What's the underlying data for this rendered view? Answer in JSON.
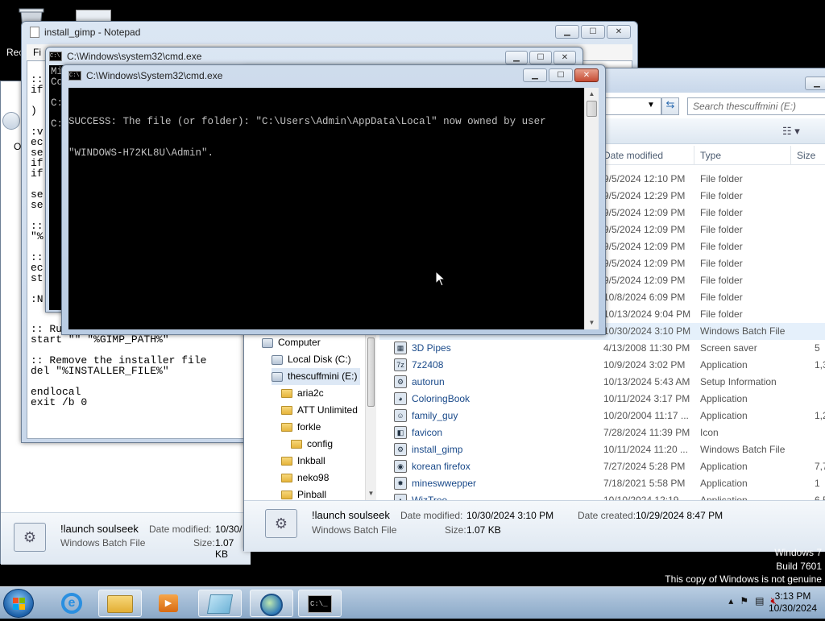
{
  "notepad": {
    "title": "install_gimp - Notepad",
    "menu_first": "Fi",
    "lines": [
      "::",
      "if",
      "",
      ")",
      "",
      ":v",
      "ec",
      "se",
      "if",
      "if",
      "",
      "se",
      "se",
      "",
      "::",
      "\"%",
      "",
      "::",
      "ec",
      "st",
      "",
      ":N"
    ],
    "bottom_lines": [
      ":: Ru",
      "start \"\" \"%GIMP_PATH%\"",
      "",
      ":: Remove the installer file",
      "del \"%INSTALLER_FILE%\"",
      "",
      "endlocal",
      "exit /b 0"
    ]
  },
  "cmd_back": {
    "title": "C:\\Windows\\system32\\cmd.exe",
    "lines": [
      "Mi",
      "Co",
      "",
      "C:",
      "",
      "C:"
    ]
  },
  "cmd_front": {
    "title": "C:\\Windows\\System32\\cmd.exe",
    "output_line1": "SUCCESS: The file (or folder): \"C:\\Users\\Admin\\AppData\\Local\" now owned by user",
    "output_line2": "\"WINDOWS-H72KL8U\\Admin\"."
  },
  "explorer": {
    "search_placeholder": "Search thescuffmini (E:)",
    "columns": {
      "date": "Date modified",
      "type": "Type",
      "size": "Size"
    },
    "folder_rows": [
      {
        "date": "9/5/2024 12:10 PM",
        "type": "File folder"
      },
      {
        "date": "9/5/2024 12:29 PM",
        "type": "File folder"
      },
      {
        "date": "9/5/2024 12:09 PM",
        "type": "File folder"
      },
      {
        "date": "9/5/2024 12:09 PM",
        "type": "File folder"
      },
      {
        "date": "9/5/2024 12:09 PM",
        "type": "File folder"
      },
      {
        "date": "9/5/2024 12:09 PM",
        "type": "File folder"
      },
      {
        "date": "9/5/2024 12:09 PM",
        "type": "File folder"
      },
      {
        "date": "10/8/2024 6:09 PM",
        "type": "File folder"
      },
      {
        "date": "10/13/2024 9:04 PM",
        "type": "File folder"
      },
      {
        "date": "10/30/2024 3:10 PM",
        "type": "Windows Batch File"
      }
    ],
    "file_rows": [
      {
        "name": "3D Pipes",
        "date": "4/13/2008 11:30 PM",
        "type": "Screen saver",
        "size": "5",
        "icon": "screensaver-icon"
      },
      {
        "name": "7z2408",
        "date": "10/9/2024 3:02 PM",
        "type": "Application",
        "size": "1,3",
        "icon": "7zip-icon"
      },
      {
        "name": "autorun",
        "date": "10/13/2024 5:43 AM",
        "type": "Setup Information",
        "size": "",
        "icon": "setup-info-icon"
      },
      {
        "name": "ColoringBook",
        "date": "10/11/2024 3:17 PM",
        "type": "Application",
        "size": "",
        "icon": "palette-icon"
      },
      {
        "name": "family_guy",
        "date": "10/20/2004 11:17 ...",
        "type": "Application",
        "size": "1,2",
        "icon": "app-icon"
      },
      {
        "name": "favicon",
        "date": "7/28/2024 11:39 PM",
        "type": "Icon",
        "size": "",
        "icon": "favicon-icon"
      },
      {
        "name": "install_gimp",
        "date": "10/11/2024 11:20 ...",
        "type": "Windows Batch File",
        "size": "",
        "icon": "batch-file-icon"
      },
      {
        "name": "korean firefox",
        "date": "7/27/2024 5:28 PM",
        "type": "Application",
        "size": "7,7",
        "icon": "firefox-icon"
      },
      {
        "name": "mineswwepper",
        "date": "7/18/2021 5:58 PM",
        "type": "Application",
        "size": "1",
        "icon": "minesweeper-icon"
      },
      {
        "name": "WizTree",
        "date": "10/10/2024 12:19 ...",
        "type": "Application",
        "size": "6,5",
        "icon": "wiztree-icon"
      }
    ],
    "tree": [
      {
        "label": "Computer",
        "indent": 0,
        "icon": "computer-icon"
      },
      {
        "label": "Local Disk (C:)",
        "indent": 1,
        "icon": "drive-icon"
      },
      {
        "label": "thescuffmini (E:)",
        "indent": 1,
        "icon": "usb-drive-icon",
        "selected": true
      },
      {
        "label": "aria2c",
        "indent": 2,
        "icon": "folder-icon"
      },
      {
        "label": "ATT Unlimited",
        "indent": 2,
        "icon": "folder-icon"
      },
      {
        "label": "forkle",
        "indent": 2,
        "icon": "folder-icon"
      },
      {
        "label": "config",
        "indent": 3,
        "icon": "folder-icon"
      },
      {
        "label": "Inkball",
        "indent": 2,
        "icon": "folder-icon"
      },
      {
        "label": "neko98",
        "indent": 2,
        "icon": "folder-icon"
      },
      {
        "label": "Pinball",
        "indent": 2,
        "icon": "folder-icon"
      }
    ],
    "details": {
      "name": "!launch soulseek",
      "type": "Windows Batch File",
      "modified_label": "Date modified:",
      "modified": "10/30/2024 3:10 PM",
      "size_label": "Size:",
      "size": "1.07 KB",
      "created_label": "Date created:",
      "created": "10/29/2024 8:47 PM"
    }
  },
  "back_explorer_details": {
    "name": "!launch soulseek",
    "type": "Windows Batch File",
    "modified_label": "Date modified:",
    "modified": "10/30/",
    "size_label": "Size:",
    "size": "1.07 KB"
  },
  "desktop": {
    "rec_label": "Rec"
  },
  "watermark": {
    "line1": "Windows 7",
    "line2": "Build 7601",
    "line3": "This copy of Windows is not genuine"
  },
  "clock": {
    "time": "3:13 PM",
    "date": "10/30/2024"
  }
}
